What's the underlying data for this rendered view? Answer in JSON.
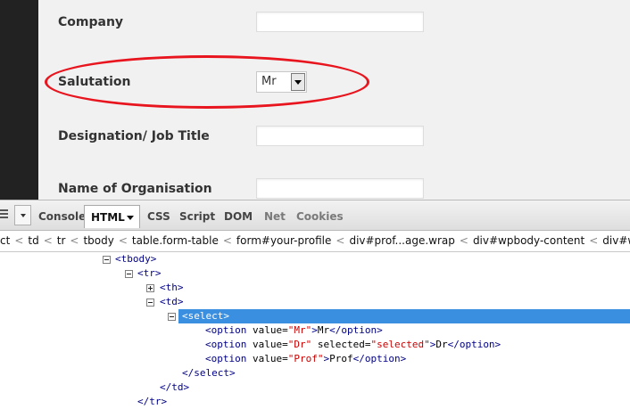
{
  "form": {
    "company_label": "Company",
    "salutation_label": "Salutation",
    "salutation_value": "Mr",
    "designation_label": "Designation/ Job Title",
    "organisation_label": "Name of Organisation"
  },
  "toolbar": {
    "tabs": [
      "Console",
      "HTML",
      "CSS",
      "Script",
      "DOM",
      "Net",
      "Cookies"
    ],
    "active_tab": "HTML"
  },
  "breadcrumb": [
    "ct",
    "td",
    "tr",
    "tbody",
    "table.form-table",
    "form#your-profile",
    "div#prof...age.wrap",
    "div#wpbody-content",
    "div#wpbody"
  ],
  "tree": {
    "tbody_open": "<tbody>",
    "tr_open": "<tr>",
    "th": "<th>",
    "td_open": "<td>",
    "select_open": "<select>",
    "options": [
      {
        "open": "<option",
        "value_attr": "value=",
        "value": "\"Mr\"",
        "close_bracket": ">",
        "text": "Mr",
        "end": "</option>"
      },
      {
        "open": "<option",
        "value_attr": "value=",
        "value": "\"Dr\"",
        "selected_attr": "selected=",
        "selected": "\"selected\"",
        "close_bracket": ">",
        "text": "Dr",
        "end": "</option>"
      },
      {
        "open": "<option",
        "value_attr": "value=",
        "value": "\"Prof\"",
        "close_bracket": ">",
        "text": "Prof",
        "end": "</option>"
      }
    ],
    "select_close": "</select>",
    "td_close": "</td>",
    "tr_close": "</tr>"
  },
  "colors": {
    "highlight_ellipse": "#e8141e",
    "selected_row": "#3b8fe0",
    "tag": "#000088",
    "attr_value": "#cc0000"
  },
  "icons": [
    "menu-icon",
    "inspect-dropdown-icon",
    "chevron-down-icon",
    "collapse-icon",
    "expand-icon"
  ]
}
